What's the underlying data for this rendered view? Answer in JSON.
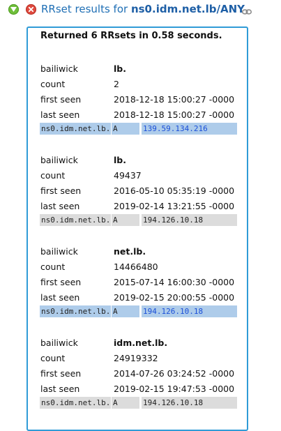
{
  "header": {
    "title_prefix": "RRset results for ",
    "query": "ns0.idm.net.lb/ANY"
  },
  "summary": "Returned 6 RRsets in 0.58 seconds.",
  "labels": {
    "bailiwick": "bailiwick",
    "count": "count",
    "first_seen": "first seen",
    "last_seen": "last seen"
  },
  "rrsets": [
    {
      "bailiwick": "lb.",
      "count": "2",
      "first_seen": "2018-12-18 15:00:27 -0000",
      "last_seen": "2018-12-18 15:00:27 -0000",
      "owner": "ns0.idm.net.lb.",
      "type": "A",
      "rdata": "139.59.134.216"
    },
    {
      "bailiwick": "lb.",
      "count": "49437",
      "first_seen": "2016-05-10 05:35:19 -0000",
      "last_seen": "2019-02-14 13:21:55 -0000",
      "owner": "ns0.idm.net.lb.",
      "type": "A",
      "rdata": "194.126.10.18"
    },
    {
      "bailiwick": "net.lb.",
      "count": "14466480",
      "first_seen": "2015-07-14 16:00:30 -0000",
      "last_seen": "2019-02-15 20:00:55 -0000",
      "owner": "ns0.idm.net.lb.",
      "type": "A",
      "rdata": "194.126.10.18"
    },
    {
      "bailiwick": "idm.net.lb.",
      "count": "24919332",
      "first_seen": "2014-07-26 03:24:52 -0000",
      "last_seen": "2019-02-15 19:47:53 -0000",
      "owner": "ns0.idm.net.lb.",
      "type": "A",
      "rdata": "194.126.10.18"
    }
  ],
  "icons": {
    "expand": "expand-icon",
    "close": "close-icon",
    "permalink": "link-icon"
  },
  "colors": {
    "title": "#1f6fb5",
    "panel_border": "#2f9bd7",
    "highlight": "#aeccea",
    "record_bg": "#dcdcdc",
    "link_text": "#1a4fd8"
  }
}
